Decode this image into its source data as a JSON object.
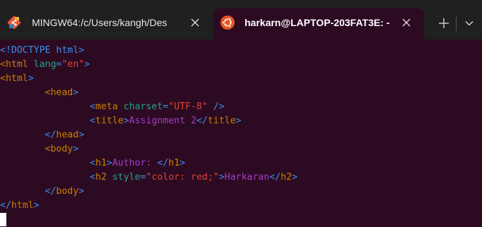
{
  "tabs": [
    {
      "title": "MINGW64:/c/Users/kangh/Des",
      "icon": "git-bash-icon",
      "active": false
    },
    {
      "title": "harkarn@LAPTOP-203FAT3E: -",
      "icon": "ubuntu-icon",
      "active": true
    }
  ],
  "tabbar": {
    "new_tab": "+",
    "dropdown": "chevron-down"
  },
  "colors": {
    "background": "#2c0a22",
    "tabbar": "#202020",
    "blue": "#3b8eea",
    "orange": "#cd7f00",
    "green": "#23a487",
    "red": "#e0453a",
    "purple": "#a23dc4"
  },
  "terminal": {
    "lines": [
      [
        {
          "t": "<!DOCTYPE html>",
          "c": "blue"
        }
      ],
      [
        {
          "t": "<html ",
          "c": "orange"
        },
        {
          "t": "lang",
          "c": "green"
        },
        {
          "t": "=",
          "c": "blue"
        },
        {
          "t": "\"en\"",
          "c": "red"
        },
        {
          "t": ">",
          "c": "blue"
        }
      ],
      [
        {
          "t": "<html",
          "c": "orange"
        },
        {
          "t": ">",
          "c": "blue"
        }
      ],
      [
        {
          "t": "        ",
          "c": ""
        },
        {
          "t": "<head",
          "c": "orange"
        },
        {
          "t": ">",
          "c": "blue"
        }
      ],
      [
        {
          "t": "                ",
          "c": ""
        },
        {
          "t": "<",
          "c": "blue"
        },
        {
          "t": "meta ",
          "c": "orange"
        },
        {
          "t": "charset",
          "c": "green"
        },
        {
          "t": "=",
          "c": "blue"
        },
        {
          "t": "\"UTF-8\"",
          "c": "red"
        },
        {
          "t": " />",
          "c": "blue"
        }
      ],
      [
        {
          "t": "                ",
          "c": ""
        },
        {
          "t": "<",
          "c": "blue"
        },
        {
          "t": "title",
          "c": "orange"
        },
        {
          "t": ">",
          "c": "blue"
        },
        {
          "t": "Assignment 2",
          "c": "purple"
        },
        {
          "t": "</",
          "c": "blue"
        },
        {
          "t": "title",
          "c": "orange"
        },
        {
          "t": ">",
          "c": "blue"
        }
      ],
      [
        {
          "t": "        ",
          "c": ""
        },
        {
          "t": "</",
          "c": "blue"
        },
        {
          "t": "head",
          "c": "orange"
        },
        {
          "t": ">",
          "c": "blue"
        }
      ],
      [
        {
          "t": "        ",
          "c": ""
        },
        {
          "t": "<body",
          "c": "orange"
        },
        {
          "t": ">",
          "c": "blue"
        }
      ],
      [
        {
          "t": "                ",
          "c": ""
        },
        {
          "t": "<",
          "c": "blue"
        },
        {
          "t": "h1",
          "c": "orange"
        },
        {
          "t": ">",
          "c": "blue"
        },
        {
          "t": "Author: ",
          "c": "purple"
        },
        {
          "t": "</",
          "c": "blue"
        },
        {
          "t": "h1",
          "c": "orange"
        },
        {
          "t": ">",
          "c": "blue"
        }
      ],
      [
        {
          "t": "                ",
          "c": ""
        },
        {
          "t": "<",
          "c": "blue"
        },
        {
          "t": "h2 ",
          "c": "orange"
        },
        {
          "t": "style",
          "c": "green"
        },
        {
          "t": "=",
          "c": "blue"
        },
        {
          "t": "\"color: red;\"",
          "c": "red"
        },
        {
          "t": ">",
          "c": "blue"
        },
        {
          "t": "Harkaran",
          "c": "purple"
        },
        {
          "t": "</",
          "c": "blue"
        },
        {
          "t": "h2",
          "c": "orange"
        },
        {
          "t": ">",
          "c": "blue"
        }
      ],
      [
        {
          "t": "        ",
          "c": ""
        },
        {
          "t": "</",
          "c": "blue"
        },
        {
          "t": "body",
          "c": "orange"
        },
        {
          "t": ">",
          "c": "blue"
        }
      ],
      [
        {
          "t": "</",
          "c": "blue"
        },
        {
          "t": "html",
          "c": "orange"
        },
        {
          "t": ">",
          "c": "blue"
        }
      ]
    ]
  }
}
